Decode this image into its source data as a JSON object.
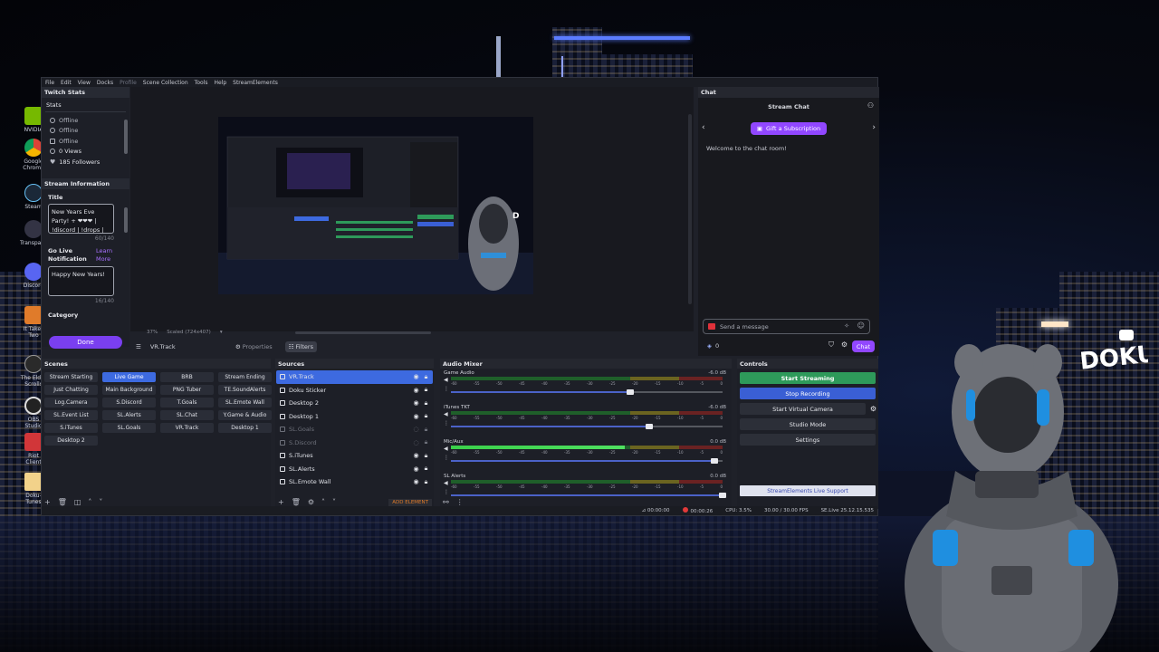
{
  "menubar": [
    "File",
    "Edit",
    "View",
    "Docks",
    "Profile",
    "Scene Collection",
    "Tools",
    "Help",
    "StreamElements"
  ],
  "twitch_stats": {
    "dock_title": "Twitch Stats",
    "section": "Stats",
    "items": [
      "Offline",
      "Offline",
      "Offline",
      "0 Views",
      "185 Followers"
    ]
  },
  "stream_info": {
    "dock_title": "Stream Information",
    "title_label": "Title",
    "title_value": "New Years Eve Party! + ❤❤❤ | !discord | !drops |",
    "title_counter": "60/140",
    "go_live_label": "Go Live Notification",
    "learn_more": "Learn More",
    "notification_value": "Happy New Years!",
    "notification_counter": "16/140",
    "category_label": "Category",
    "done": "Done"
  },
  "preview_bar": {
    "zoom": "37%",
    "scaled": "Scaled (724x407)"
  },
  "source_toolbar": {
    "source_name": "VR.Track",
    "properties": "Properties",
    "filters": "Filters"
  },
  "chat": {
    "dock_title": "Chat",
    "header": "Stream Chat",
    "gift": "Gift a Subscription",
    "welcome": "Welcome to the chat room!",
    "placeholder": "Send a message",
    "points": "0",
    "button": "Chat"
  },
  "scenes": {
    "title": "Scenes",
    "items": [
      "Stream Starting",
      "Live Game",
      "BRB",
      "Stream Ending",
      "Just Chatting",
      "Main Background",
      "PNG Tuber",
      "TE.SoundAlerts",
      "Log.Camera",
      "S.Discord",
      "T.Goals",
      "SL.Emote Wall",
      "SL.Event List",
      "SL.Alerts",
      "SL.Chat",
      "Y.Game & Audio",
      "S.iTunes",
      "SL.Goals",
      "VR.Track",
      "Desktop 1",
      "Desktop 2"
    ],
    "active": "Live Game"
  },
  "sources": {
    "title": "Sources",
    "items": [
      {
        "name": "VR.Track",
        "selected": true,
        "hidden": false
      },
      {
        "name": "Doku Sticker",
        "selected": false,
        "hidden": false
      },
      {
        "name": "Desktop 2",
        "selected": false,
        "hidden": false
      },
      {
        "name": "Desktop 1",
        "selected": false,
        "hidden": false
      },
      {
        "name": "SL.Goals",
        "selected": false,
        "hidden": true
      },
      {
        "name": "S.Discord",
        "selected": false,
        "hidden": true
      },
      {
        "name": "S.iTunes",
        "selected": false,
        "hidden": false
      },
      {
        "name": "SL.Alerts",
        "selected": false,
        "hidden": false
      },
      {
        "name": "SL.Emote Wall",
        "selected": false,
        "hidden": false
      }
    ],
    "add_element": "ADD ELEMENT"
  },
  "audio_mixer": {
    "title": "Audio Mixer",
    "ticks": [
      "-60",
      "-55",
      "-50",
      "-45",
      "-40",
      "-35",
      "-30",
      "-25",
      "-20",
      "-15",
      "-10",
      "-5",
      "0"
    ],
    "channels": [
      {
        "name": "Game Audio",
        "db": "-6.0 dB",
        "level": 0.0,
        "volume": 0.66
      },
      {
        "name": "iTunes TKT",
        "db": "-6.0 dB",
        "level": 0.0,
        "volume": 0.73
      },
      {
        "name": "Mic/Aux",
        "db": "0.0 dB",
        "level": 0.64,
        "volume": 0.97
      },
      {
        "name": "SL Alerts",
        "db": "0.0 dB",
        "level": 0.0,
        "volume": 1.0
      }
    ]
  },
  "controls": {
    "title": "Controls",
    "start_streaming": "Start Streaming",
    "stop_recording": "Stop Recording",
    "virtual_camera": "Start Virtual Camera",
    "studio_mode": "Studio Mode",
    "settings": "Settings",
    "support": "StreamElements Live Support"
  },
  "status": {
    "stream_time": "00:00:00",
    "rec_time": "00:00:26",
    "cpu": "CPU: 3.5%",
    "fps": "30.00 / 30.00 FPS",
    "version": "SE.Live 25.12.15.535"
  },
  "desktop_icons": [
    "NVIDIA",
    "Google Chrome",
    "Steam",
    "Transparent",
    "Discord",
    "It Takes Two",
    "The Elder Scrolls",
    "OBS Studio",
    "Riot Client",
    "Doku-Tunes"
  ],
  "colors": {
    "accent_purple": "#9147ff",
    "obs_blue": "#3d6ae0",
    "start_green": "#2e9a5a"
  }
}
